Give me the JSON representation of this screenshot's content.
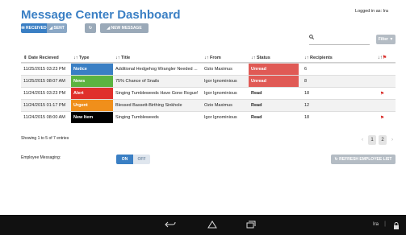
{
  "header": {
    "title": "Message Center Dashboard",
    "logged_in": "Logged in as: Ira"
  },
  "toolbar": {
    "received_label": "RECEIVED",
    "sent_label": "SENT",
    "new_message_label": "NEW MESSAGE",
    "filter_label": "Filter",
    "search_placeholder": ""
  },
  "table": {
    "headers": {
      "date": "Date Recieved",
      "type": "Type",
      "title": "Title",
      "from": "From",
      "status": "Status",
      "recipients": "Recipients"
    },
    "rows": [
      {
        "date": "11/25/2015 03:23 PM",
        "type": "Notice",
        "type_color": "#3a7fc4",
        "title": "Additional Hedgehog Wrangler Needed ...",
        "from": "Ozio Maximus",
        "status": "Unread",
        "recipients": "6",
        "flag": false
      },
      {
        "date": "11/25/2015 08:07 AM",
        "type": "News",
        "type_color": "#5bb340",
        "title": "75% Chance of Snails",
        "from": "Igor Ignominious",
        "status": "Unread",
        "recipients": "8",
        "flag": false
      },
      {
        "date": "11/24/2015 03:23 PM",
        "type": "Alert",
        "type_color": "#e0302b",
        "title": "Singing Tumbleweeds Have Gone Rogue!",
        "from": "Igor Ignominious",
        "status": "Read",
        "recipients": "18",
        "flag": true
      },
      {
        "date": "11/24/2015 01:17 PM",
        "type": "Urgent",
        "type_color": "#f08f1b",
        "title": "Blessed Bassett-Birthing Sinkhole",
        "from": "Ozio Maximus",
        "status": "Read",
        "recipients": "12",
        "flag": false
      },
      {
        "date": "11/24/2015 08:00 AM",
        "type": "New Item",
        "type_color": "#000000",
        "title": "Singing Tumbleweeds",
        "from": "Igor Ignominious",
        "status": "Read",
        "recipients": "18",
        "flag": true
      }
    ]
  },
  "footer": {
    "showing": "Showing 1 to 5 of 7 entries",
    "pages": [
      "1",
      "2"
    ],
    "employee_label": "Employee Messaging:",
    "toggle_on": "ON",
    "toggle_off": "OFF",
    "refresh_list_label": "REFRESH EMPLOYEE LIST"
  },
  "navbar": {
    "user": "Ira",
    "separator": "|"
  },
  "colors": {
    "accent": "#3a7fc4",
    "unread": "#e05a55",
    "flag": "#d9302c"
  }
}
